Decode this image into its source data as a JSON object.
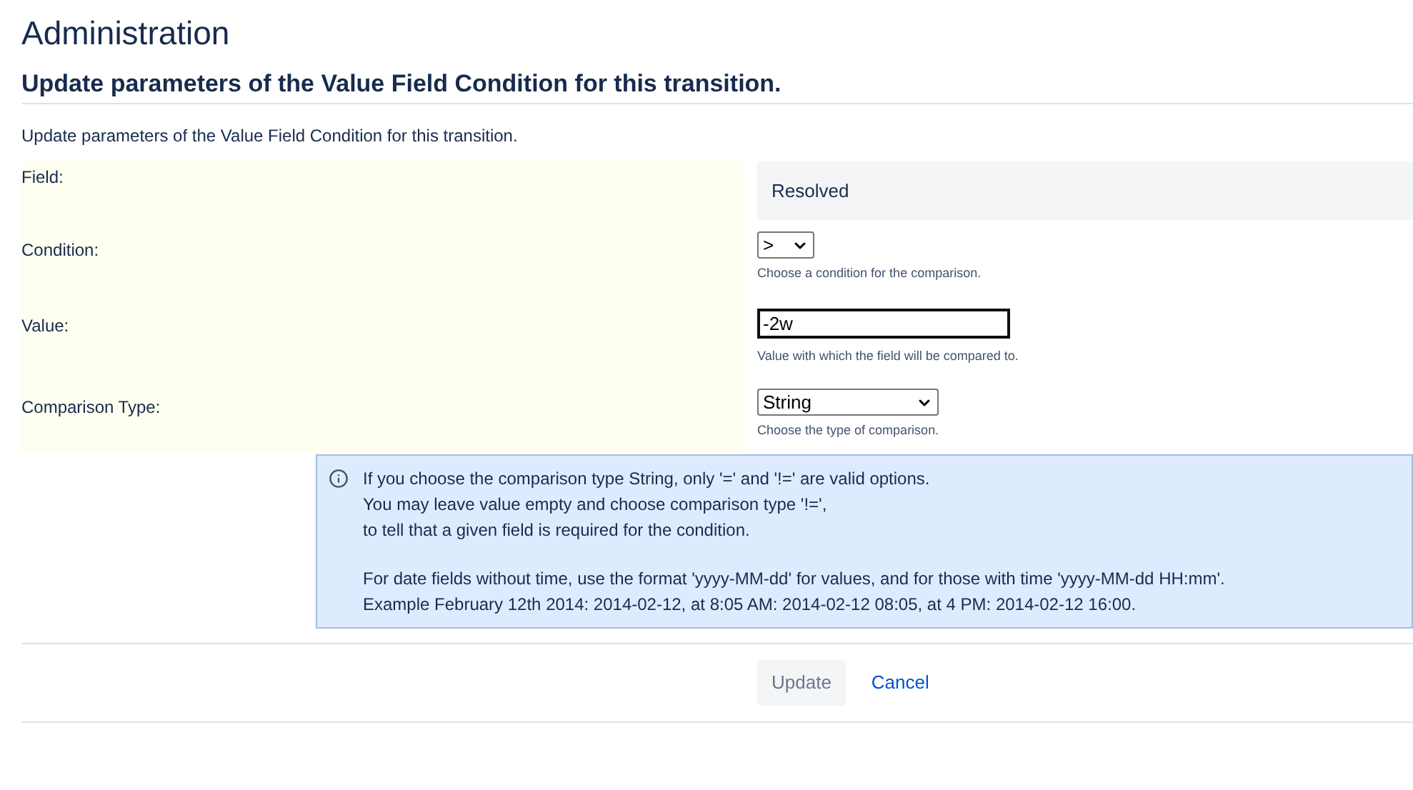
{
  "page_title": "Administration",
  "section_title": "Update parameters of the Value Field Condition for this transition.",
  "description": "Update parameters of the Value Field Condition for this transition.",
  "fields": [
    {
      "label": "Field:",
      "kind": "static",
      "value": "Resolved"
    },
    {
      "label": "Condition:",
      "kind": "select",
      "value": ">",
      "help": "Choose a condition for the comparison."
    },
    {
      "label": "Value:",
      "kind": "text",
      "value": "-2w",
      "help": "Value with which the field will be compared to."
    },
    {
      "label": "Comparison Type:",
      "kind": "select",
      "value": "String",
      "help": "Choose the type of comparison."
    }
  ],
  "info": {
    "paragraphs": [
      [
        "If you choose the comparison type String, only '=' and '!=' are valid options.",
        "You may leave value empty and choose comparison type '!=',",
        "to tell that a given field is required for the condition."
      ],
      [
        "For date fields without time, use the format 'yyyy-MM-dd' for values, and for those with time 'yyyy-MM-dd HH:mm'.",
        "Example February 12th 2014: 2014-02-12, at 8:05 AM: 2014-02-12 08:05, at 4 PM: 2014-02-12 16:00."
      ]
    ]
  },
  "buttons": [
    {
      "label": "Update",
      "kind": "button"
    },
    {
      "label": "Cancel",
      "kind": "link"
    }
  ]
}
